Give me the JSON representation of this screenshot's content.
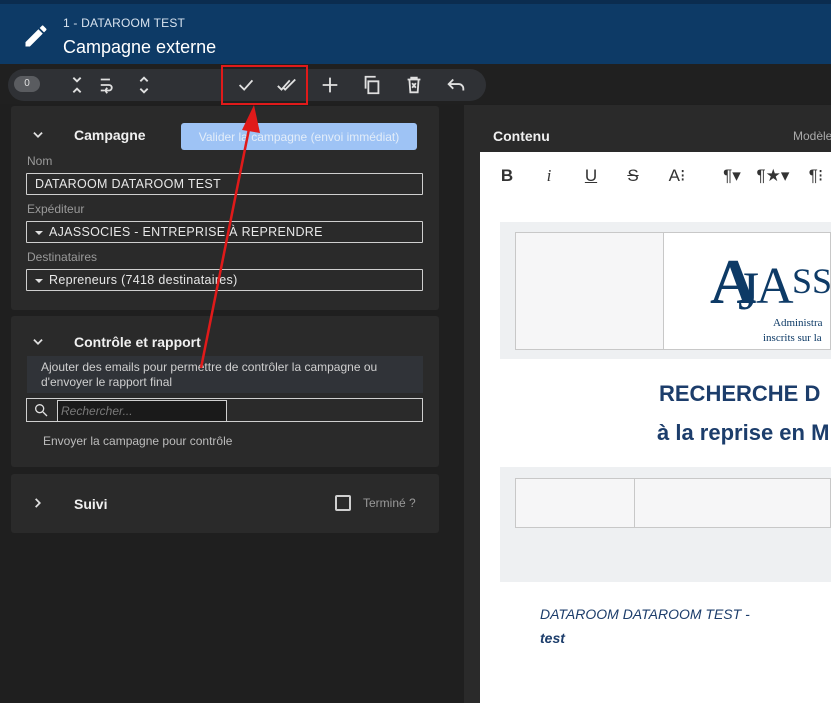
{
  "header": {
    "subtitle": "1 - DATAROOM TEST",
    "title": "Campagne externe"
  },
  "toolbar": {
    "counter": "0"
  },
  "campagne": {
    "title": "Campagne",
    "validate_label": "Valider la campagne (envoi immédiat)",
    "nom_label": "Nom",
    "nom_value": "DATAROOM DATAROOM TEST",
    "expediteur_label": "Expéditeur",
    "expediteur_value": "AJASSOCIES - ENTREPRISE À REPRENDRE",
    "destinataires_label": "Destinataires",
    "destinataires_value": "Repreneurs (7418 destinataires)"
  },
  "controle": {
    "title": "Contrôle et rapport",
    "info_line1": "Ajouter des emails pour permettre de contrôler la campagne ou",
    "info_line2": "d'envoyer le rapport final",
    "search_placeholder": "Rechercher...",
    "send_label": "Envoyer la campagne pour contrôle"
  },
  "suivi": {
    "title": "Suivi",
    "termine_label": "Terminé ?"
  },
  "contenu": {
    "title": "Contenu",
    "modeles_label": "Modèle",
    "logo_text": "AJASS",
    "logo_sub1": "Administra",
    "logo_sub2": "inscrits sur la",
    "heading1": "RECHERCHE D",
    "heading2": "à la reprise en M",
    "footer_line1": "DATAROOM DATAROOM TEST -",
    "footer_line2": "test"
  },
  "colors": {
    "header_bg": "#0d3a66",
    "highlight": "#e01a1a",
    "validate_btn": "#9ec3f5",
    "doc_heading": "#1c3d6b"
  }
}
